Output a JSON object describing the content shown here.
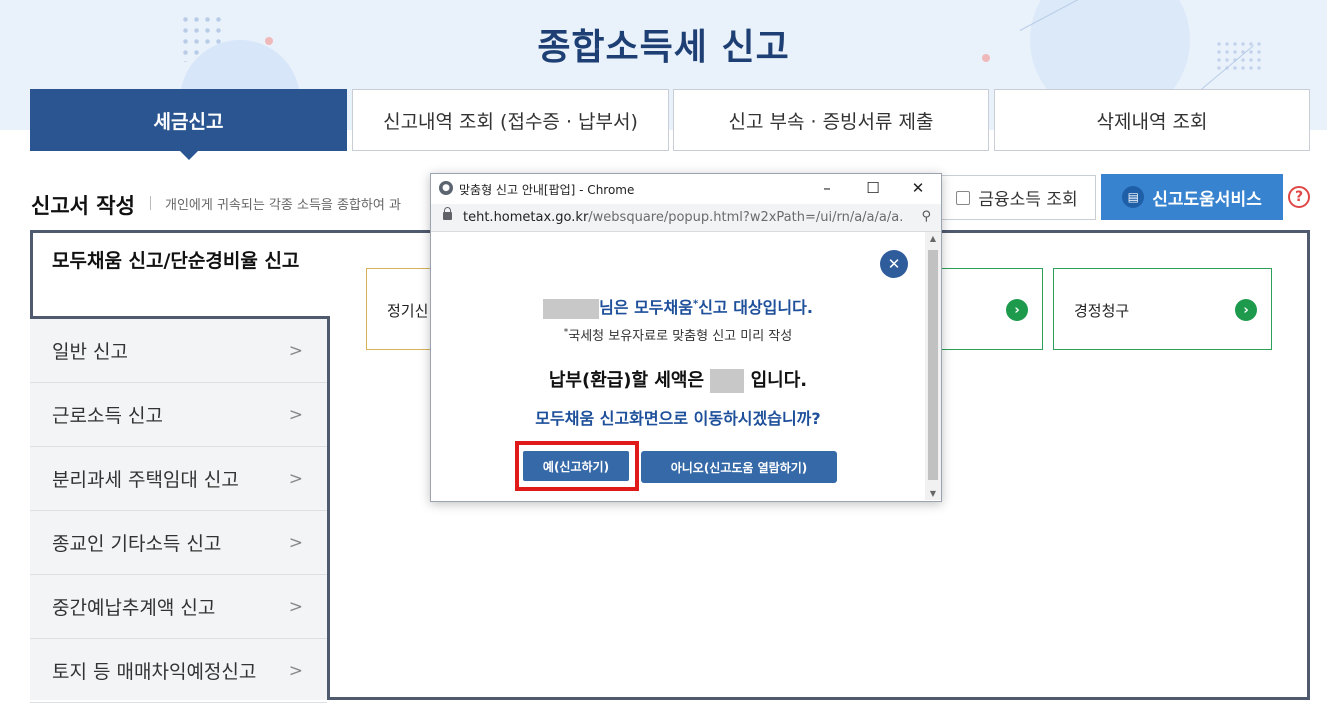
{
  "header": {
    "title": "종합소득세 신고"
  },
  "tabs": [
    {
      "label": "세금신고",
      "active": true
    },
    {
      "label": "신고내역 조회 (접수증 · 납부서)",
      "active": false
    },
    {
      "label": "신고 부속 · 증빙서류 제출",
      "active": false
    },
    {
      "label": "삭제내역 조회",
      "active": false
    }
  ],
  "section": {
    "title": "신고서 작성",
    "description": "개인에게 귀속되는 각종 소득을 종합하여 과",
    "financial_income_button": "금융소득 조회",
    "help_service_button": "신고도움서비스",
    "help_icon": "?"
  },
  "sidebar": {
    "active_item": "모두채움 신고/단순경비율 신고",
    "items": [
      {
        "label": "일반 신고"
      },
      {
        "label": "근로소득 신고"
      },
      {
        "label": "분리과세 주택임대 신고"
      },
      {
        "label": "종교인 기타소득 신고"
      },
      {
        "label": "중간예납추계액 신고"
      },
      {
        "label": "토지 등 매매차익예정신고"
      }
    ]
  },
  "cards": [
    {
      "label": "정기신"
    },
    {
      "label": ""
    },
    {
      "label": "경정청구"
    }
  ],
  "popup": {
    "window_title": "맞춤형 신고 안내[팝업] - Chrome",
    "url_host": "teht.hometax.go.kr",
    "url_path": "/websquare/popup.html?w2xPath=/ui/rn/a/a/a/a...",
    "message_line1_suffix": "님은 모두채움",
    "message_line1_sup": "*",
    "message_line1_end": "신고 대상입니다.",
    "message_line2_sup": "*",
    "message_line2": "국세청 보유자료로 맞춤형 신고 미리 작성",
    "message_line3_prefix": "납부(환급)할 세액은",
    "message_line3_suffix": "입니다.",
    "message_line4": "모두채움 신고화면으로 이동하시겠습니까?",
    "yes_button": "예(신고하기)",
    "no_button": "아니오(신고도움 열람하기)"
  },
  "colors": {
    "brand_navy": "#2a5591",
    "title_navy": "#1d3f73",
    "help_blue": "#3883cf",
    "highlight_red": "#e01919",
    "go_green": "#1e9a4d"
  }
}
